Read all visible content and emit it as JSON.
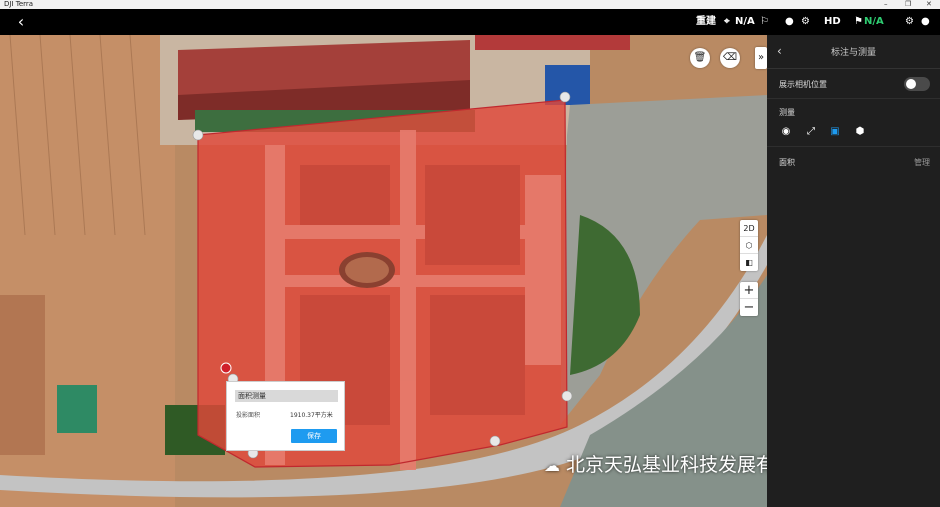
{
  "window": {
    "title": "DJI Terra"
  },
  "topbar": {
    "status_rebuild": "重建",
    "status_na1": "N/A",
    "status_hd": "HD",
    "status_na2": "N/A"
  },
  "panel": {
    "title": "标注与测量",
    "show_camera_label": "展示相机位置",
    "measure_label": "测量",
    "area_label": "面积",
    "manage_label": "管理"
  },
  "popup": {
    "title": "面积测量",
    "label": "投影面积",
    "value": "1910.37平方米",
    "save": "保存"
  },
  "map_controls": {
    "view_2d": "2D",
    "zoom_in": "+",
    "zoom_out": "−",
    "collapse": "»"
  },
  "watermark": {
    "text": "北京天弘基业科技发展有限公司"
  },
  "colors": {
    "accent": "#1e9bf0",
    "status_green": "#2ecc71",
    "measure_fill": "#e0483a"
  }
}
